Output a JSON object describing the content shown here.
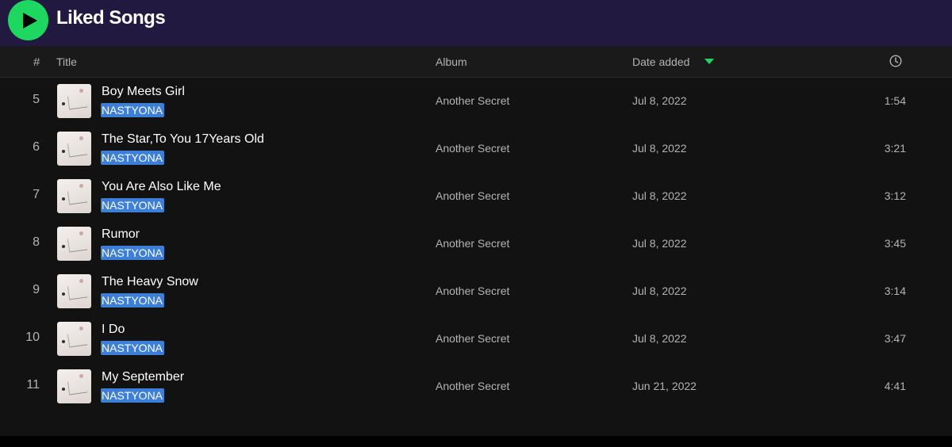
{
  "header": {
    "title": "Liked Songs",
    "play_icon": "play-icon",
    "accent_color": "#1ed760",
    "bar_color": "#221940"
  },
  "columns": {
    "number": "#",
    "title": "Title",
    "album": "Album",
    "date_added": "Date added",
    "sort_icon": "caret-down-icon",
    "duration_icon": "clock-icon"
  },
  "tracks": [
    {
      "number": "5",
      "title": "Boy Meets Girl",
      "artist": "NASTYONA",
      "album": "Another Secret",
      "date_added": "Jul 8, 2022",
      "duration": "1:54"
    },
    {
      "number": "6",
      "title": "The Star,To You 17Years Old",
      "artist": "NASTYONA",
      "album": "Another Secret",
      "date_added": "Jul 8, 2022",
      "duration": "3:21"
    },
    {
      "number": "7",
      "title": "You Are Also Like Me",
      "artist": "NASTYONA",
      "album": "Another Secret",
      "date_added": "Jul 8, 2022",
      "duration": "3:12"
    },
    {
      "number": "8",
      "title": "Rumor",
      "artist": "NASTYONA",
      "album": "Another Secret",
      "date_added": "Jul 8, 2022",
      "duration": "3:45"
    },
    {
      "number": "9",
      "title": "The Heavy Snow",
      "artist": "NASTYONA",
      "album": "Another Secret",
      "date_added": "Jul 8, 2022",
      "duration": "3:14"
    },
    {
      "number": "10",
      "title": "I Do",
      "artist": "NASTYONA",
      "album": "Another Secret",
      "date_added": "Jul 8, 2022",
      "duration": "3:47"
    },
    {
      "number": "11",
      "title": "My September",
      "artist": "NASTYONA",
      "album": "Another Secret",
      "date_added": "Jun 21, 2022",
      "duration": "4:41"
    }
  ]
}
